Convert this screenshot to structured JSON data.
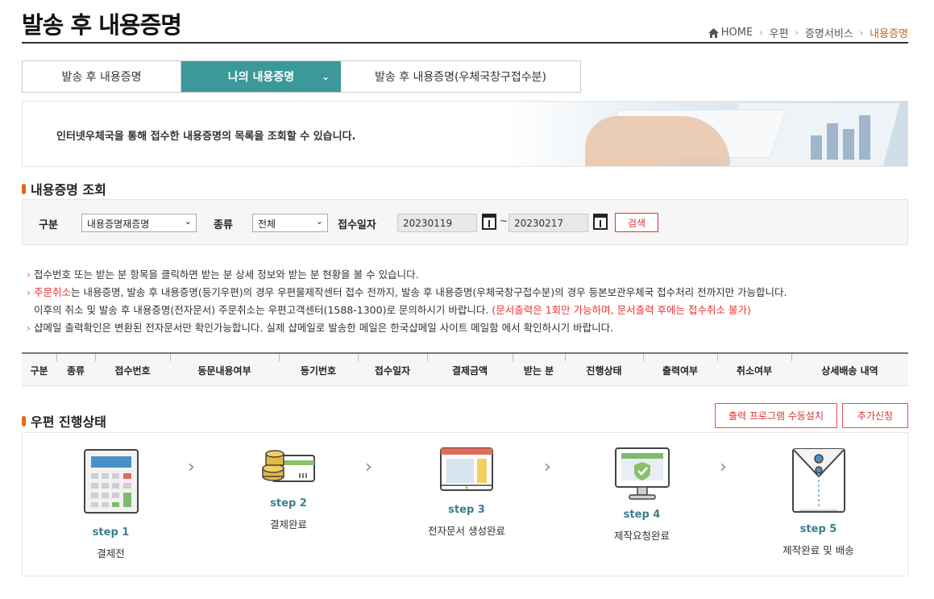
{
  "page": {
    "title": "발송 후 내용증명"
  },
  "breadcrumb": {
    "home": "HOME",
    "item1": "우편",
    "item2": "증명서비스",
    "current": "내용증명",
    "sep": "›"
  },
  "tabs": [
    {
      "label": "발송 후 내용증명"
    },
    {
      "label": "나의 내용증명",
      "chevron": "⌄"
    },
    {
      "label": "발송 후 내용증명(우체국창구접수분)"
    }
  ],
  "banner": {
    "text": "인터넷우체국을 통해 접수한 내용증명의 목록을 조회할 수 있습니다."
  },
  "search": {
    "section_title": "내용증명 조회",
    "category_label": "구분",
    "category_value": "내용증명재증명",
    "type_label": "종류",
    "type_value": "전체",
    "date_label": "접수일자",
    "date_from": "20230119",
    "date_to": "20230217",
    "tilde": "~",
    "search_button": "검색"
  },
  "notes": {
    "bullet": "›",
    "line1": "접수번호 또는 받는 분 항목을 클릭하면 받는 분 상세 정보와 받는 분 현황을 볼 수 있습니다.",
    "line2_red": "주문취소",
    "line2": "는 내용증명, 발송 후 내용증명(등기우편)의 경우 우편물제작센터 접수 전까지, 발송 후 내용증명(우체국창구접수분)의 경우 등본보관우체국 접수처리 전까지만 가능합니다.",
    "line3": "이후의 취소 및 발송 후 내용증명(전자문서) 주문취소는 우편고객센터(1588-1300)로 문의하시기 바랍니다. ",
    "line3_red": "(문서출력은 1회만 가능하며, 문서출력 후에는 접수취소 불가)",
    "line4": "샵메일 출력확인은 변환된 전자문서만 확인가능합니다. 실제 샵메일로 발송한 메일은 한국샵메일 사이트 메일함 에서 확인하시기 바랍니다."
  },
  "table": {
    "columns": [
      "구분",
      "종류",
      "접수번호",
      "동문내용여부",
      "등기번호",
      "접수일자",
      "결제금액",
      "받는 분",
      "진행상태",
      "출력여부",
      "취소여부",
      "상세배송 내역"
    ]
  },
  "progress": {
    "section_title": "우편 진행상태",
    "install_button": "출력 프로그램 수동설치",
    "add_button": "추가신청",
    "arrow": "›",
    "steps": [
      {
        "name": "step 1",
        "desc": "결제전",
        "icon": "calculator-icon"
      },
      {
        "name": "step 2",
        "desc": "결제완료",
        "icon": "coins-card-icon"
      },
      {
        "name": "step 3",
        "desc": "전자문서 생성완료",
        "icon": "document-screen-icon"
      },
      {
        "name": "step 4",
        "desc": "제작요청완료",
        "icon": "monitor-shield-icon"
      },
      {
        "name": "step 5",
        "desc": "제작완료 및 배송",
        "icon": "envelope-icon"
      }
    ]
  },
  "colors": {
    "teal": "#3b9999",
    "orange": "#e06a1b",
    "red": "#dd3333",
    "step_text": "#3b7f8f"
  }
}
